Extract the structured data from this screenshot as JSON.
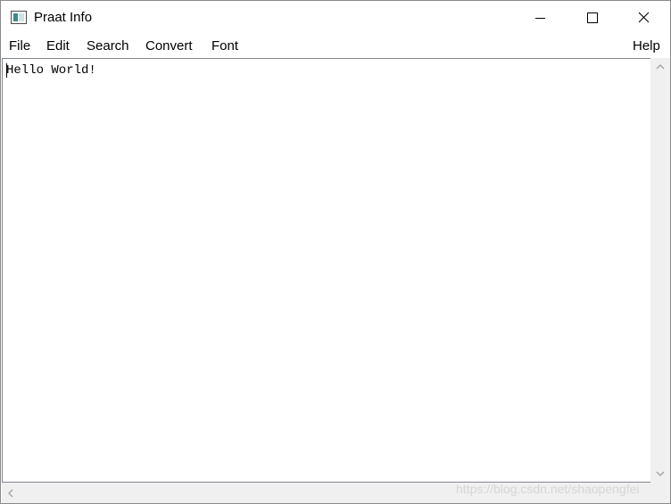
{
  "window": {
    "title": "Praat Info",
    "icon": "praat-app-icon",
    "controls": [
      "minimize-icon",
      "maximize-icon",
      "close-icon"
    ]
  },
  "menubar": {
    "file": "File",
    "edit": "Edit",
    "search": "Search",
    "convert": "Convert",
    "font": "Font",
    "help": "Help"
  },
  "editor": {
    "text": "Hello World!"
  },
  "scrollbars": {
    "vertical_icons": [
      "chevron-up-icon",
      "chevron-down-icon"
    ],
    "horizontal_icons": [
      "chevron-left-icon"
    ]
  },
  "watermark": "https://blog.csdn.net/shaopengfei"
}
